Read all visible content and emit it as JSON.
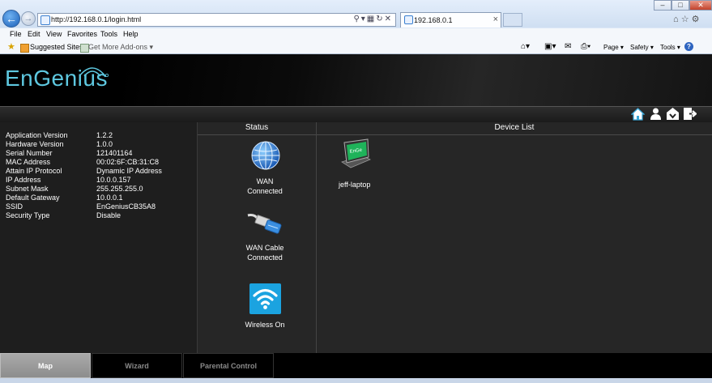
{
  "browser": {
    "url": "http://192.168.0.1/login.html",
    "tab_title": "192.168.0.1",
    "menu": [
      "File",
      "Edit",
      "View",
      "Favorites",
      "Tools",
      "Help"
    ],
    "favorites": {
      "suggested_sites": "Suggested Sites",
      "get_more_addons": "Get More Add-ons ▾"
    },
    "command_bar": {
      "page": "Page ▾",
      "safety": "Safety ▾",
      "tools": "Tools ▾"
    }
  },
  "brand": {
    "logo_text": "EnGenius",
    "accent": "#5ec8e0"
  },
  "info": {
    "rows": [
      {
        "label": "Application Version",
        "value": "1.2.2"
      },
      {
        "label": "Hardware Version",
        "value": "1.0.0"
      },
      {
        "label": "Serial Number",
        "value": "121401164"
      },
      {
        "label": "MAC Address",
        "value": "00:02:6F:CB:31:C8"
      },
      {
        "label": "Attain IP Protocol",
        "value": "Dynamic IP Address"
      },
      {
        "label": "IP Address",
        "value": "10.0.0.157"
      },
      {
        "label": "Subnet Mask",
        "value": "255.255.255.0"
      },
      {
        "label": "Default Gateway",
        "value": "10.0.0.1"
      },
      {
        "label": "SSID",
        "value": "EnGeniusCB35A8"
      },
      {
        "label": "Security Type",
        "value": "Disable"
      }
    ]
  },
  "status": {
    "header": "Status",
    "wan": {
      "line1": "WAN",
      "line2": "Connected"
    },
    "cable": {
      "line1": "WAN Cable",
      "line2": "Connected"
    },
    "wireless": {
      "line1": "Wireless On"
    }
  },
  "device_list": {
    "header": "Device List",
    "devices": [
      {
        "name": "jeff-laptop",
        "screen_text": "EnGe"
      }
    ]
  },
  "tabs": [
    {
      "label": "Map",
      "active": true
    },
    {
      "label": "Wizard",
      "active": false
    },
    {
      "label": "Parental Control",
      "active": false
    }
  ]
}
